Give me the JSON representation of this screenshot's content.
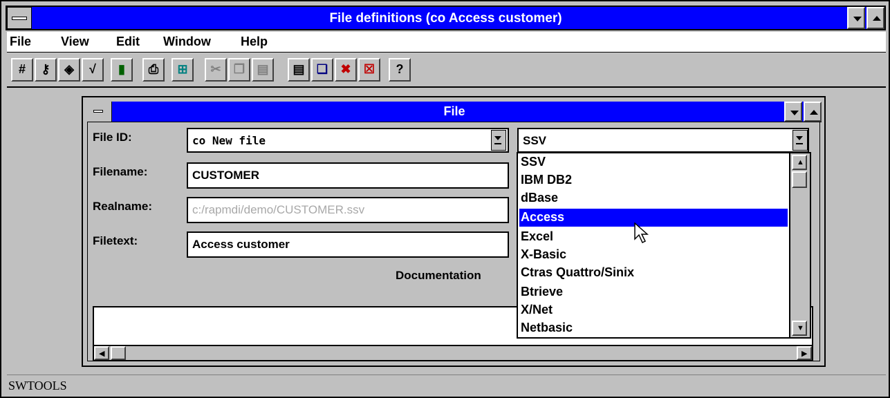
{
  "app": {
    "title": "File definitions (co Access customer)"
  },
  "menu": [
    {
      "label": "File"
    },
    {
      "label": "View"
    },
    {
      "label": "Edit"
    },
    {
      "label": "Window"
    },
    {
      "label": "Help"
    }
  ],
  "toolbar": {
    "buttons": [
      {
        "name": "hash-icon",
        "glyph": "#"
      },
      {
        "name": "key-icon",
        "glyph": "⚷"
      },
      {
        "name": "eraser-icon",
        "glyph": "◈"
      },
      {
        "name": "check-icon",
        "glyph": "√"
      },
      {
        "name": "trash-icon",
        "glyph": "▮"
      },
      {
        "name": "print-icon",
        "glyph": "⎙"
      },
      {
        "name": "hierarchy-icon",
        "glyph": "⊞"
      },
      {
        "name": "cut-icon",
        "glyph": "✂"
      },
      {
        "name": "copy-icon",
        "glyph": "❐"
      },
      {
        "name": "paste-icon",
        "glyph": "▤"
      },
      {
        "name": "tile-icon",
        "glyph": "▤"
      },
      {
        "name": "cascade-icon",
        "glyph": "❏"
      },
      {
        "name": "close-windows-icon",
        "glyph": "✖"
      },
      {
        "name": "close-all-icon",
        "glyph": "☒"
      },
      {
        "name": "help-icon",
        "glyph": "?"
      }
    ]
  },
  "child": {
    "title": "File",
    "labels": {
      "file_id": "File ID:",
      "filename": "Filename:",
      "realname": "Realname:",
      "filetext": "Filetext:",
      "documentation": "Documentation"
    },
    "values": {
      "file_id": "co  New file",
      "filename": "CUSTOMER",
      "realname": "c:/rapmdi/demo/CUSTOMER.ssv",
      "filetext": "Access customer",
      "type": "SSV"
    }
  },
  "droplist": {
    "options": [
      "SSV",
      "IBM DB2",
      "dBase",
      "Access",
      "Excel",
      "X-Basic",
      "Ctras Quattro/Sinix",
      "Btrieve",
      "X/Net",
      "Netbasic"
    ],
    "selected": "Access"
  },
  "status": {
    "text": "SWTOOLS"
  },
  "colors": {
    "titlebar": "#0000ff",
    "face": "#c0c0c0",
    "selection": "#0000ff"
  }
}
